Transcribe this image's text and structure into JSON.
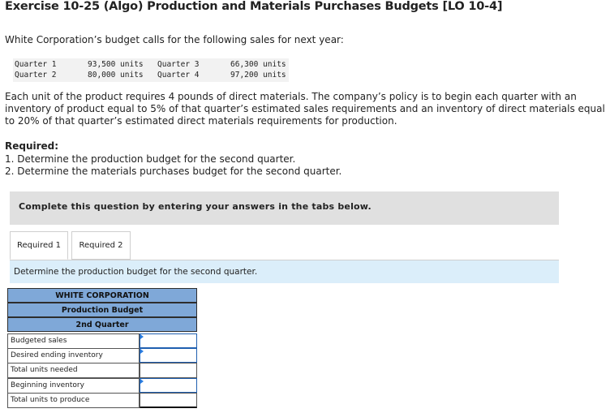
{
  "title": "Exercise 10-25 (Algo) Production and Materials Purchases Budgets [LO 10-4]",
  "intro": "White Corporation’s budget calls for the following sales for next year:",
  "sales": [
    {
      "q_left": "Quarter 1",
      "v_left": "93,500 units",
      "q_right": "Quarter 3",
      "v_right": "66,300 units"
    },
    {
      "q_left": "Quarter 2",
      "v_left": "80,000 units",
      "q_right": "Quarter 4",
      "v_right": "97,200 units"
    }
  ],
  "paragraph": "Each unit of the product requires 4 pounds of direct materials. The company’s policy is to begin each quarter with an inventory of product equal to 5% of that quarter’s estimated sales requirements and an inventory of direct materials equal to 20% of that quarter’s estimated direct materials requirements for production.",
  "required": {
    "heading": "Required:",
    "items": [
      "1. Determine the production budget for the second quarter.",
      "2. Determine the materials purchases budget for the second quarter."
    ]
  },
  "banner": "Complete this question by entering your answers in the tabs below.",
  "tabs": [
    "Required 1",
    "Required 2"
  ],
  "instruction": "Determine the production budget for the second quarter.",
  "table": {
    "headers": [
      "WHITE CORPORATION",
      "Production Budget",
      "2nd Quarter"
    ],
    "rows": [
      {
        "label": "Budgeted sales",
        "value": ""
      },
      {
        "label": "Desired ending inventory",
        "value": ""
      },
      {
        "label": "Total units needed",
        "value": ""
      },
      {
        "label": "Beginning inventory",
        "value": ""
      },
      {
        "label": "Total units to produce",
        "value": ""
      }
    ]
  },
  "colors": {
    "header_bg": "#7fa8d8",
    "instruction_bg": "#dbeefa",
    "banner_bg": "#e0e0e0",
    "input_marker": "#2a7de1"
  }
}
